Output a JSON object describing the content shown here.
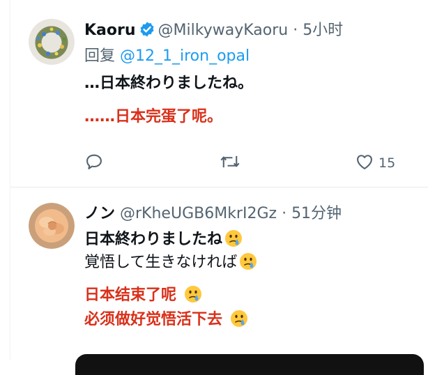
{
  "tweets": [
    {
      "name": "Kaoru",
      "handle": "@MilkywayKaoru",
      "separator": "·",
      "time": "5小时",
      "verified": true,
      "reply_label": "回复",
      "reply_mention": "@12_1_iron_opal",
      "text_original": "…日本終わりましたね。",
      "text_translation": "……日本完蛋了呢。",
      "actions": {
        "reply_icon": "comment-icon",
        "retweet_icon": "retweet-icon",
        "like_icon": "heart-icon",
        "like_count": "15"
      }
    },
    {
      "name": "ノン",
      "handle": "@rKheUGB6MkrI2Gz",
      "separator": "·",
      "time": "51分钟",
      "line1": "日本終わりましたね",
      "line2": "覚悟して生きなければ",
      "line3": "日本结束了呢 ",
      "line4": "必须做好觉悟活下去 ",
      "emoji": "crying-face-icon"
    }
  ],
  "colors": {
    "accent_blue": "#1d9bf0",
    "translation_red": "#d9301a",
    "secondary_text": "#536471"
  }
}
